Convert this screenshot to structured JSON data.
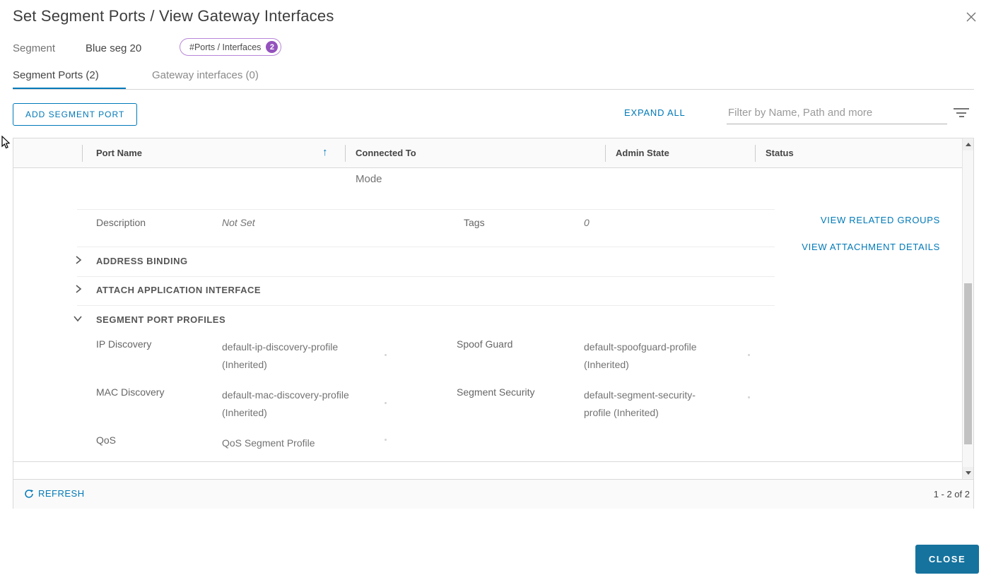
{
  "dialog": {
    "title": "Set Segment Ports / View Gateway Interfaces",
    "close_button_label": "CLOSE"
  },
  "meta": {
    "segment_label": "Segment",
    "segment_name": "Blue seg 20",
    "ports_badge": {
      "label": "#Ports / Interfaces",
      "count": "2"
    }
  },
  "tabs": [
    {
      "label": "Segment Ports (2)",
      "active": true
    },
    {
      "label": "Gateway interfaces (0)",
      "active": false
    }
  ],
  "toolbar": {
    "add_segment_port": "ADD SEGMENT PORT",
    "expand_all": "EXPAND ALL",
    "filter_placeholder": "Filter by Name, Path and more"
  },
  "grid": {
    "columns": [
      "Port Name",
      "Connected To",
      "Admin State",
      "Status"
    ],
    "sort_arrow": "↑",
    "partial_row_text": "Mode",
    "detail": {
      "description_label": "Description",
      "description_value": "Not Set",
      "tags_label": "Tags",
      "tags_count": "0",
      "links": [
        "VIEW RELATED GROUPS",
        "VIEW ATTACHMENT DETAILS"
      ],
      "sections": [
        {
          "label": "ADDRESS BINDING",
          "expanded": false
        },
        {
          "label": "ATTACH APPLICATION INTERFACE",
          "expanded": false
        },
        {
          "label": "SEGMENT PORT PROFILES",
          "expanded": true
        }
      ],
      "profiles": [
        {
          "label": "IP Discovery",
          "value_line1": "default-ip-discovery-profile",
          "value_line2": "(Inherited)"
        },
        {
          "label": "Spoof Guard",
          "value_line1": "default-spoofguard-profile",
          "value_line2": "(Inherited)"
        },
        {
          "label": "MAC Discovery",
          "value_line1": "default-mac-discovery-profile",
          "value_line2": "(Inherited)"
        },
        {
          "label": "Segment Security",
          "value_line1": "default-segment-security-",
          "value_line2": "profile (Inherited)"
        },
        {
          "label": "QoS",
          "value_line1": "QoS Segment Profile",
          "value_line2": ""
        }
      ]
    },
    "footer": {
      "refresh_label": "REFRESH",
      "pagination": "1 - 2 of 2"
    }
  },
  "colors": {
    "accent_blue": "#0079b8",
    "badge_purple": "#9452bd",
    "primary_button_blue": "#16739e"
  }
}
